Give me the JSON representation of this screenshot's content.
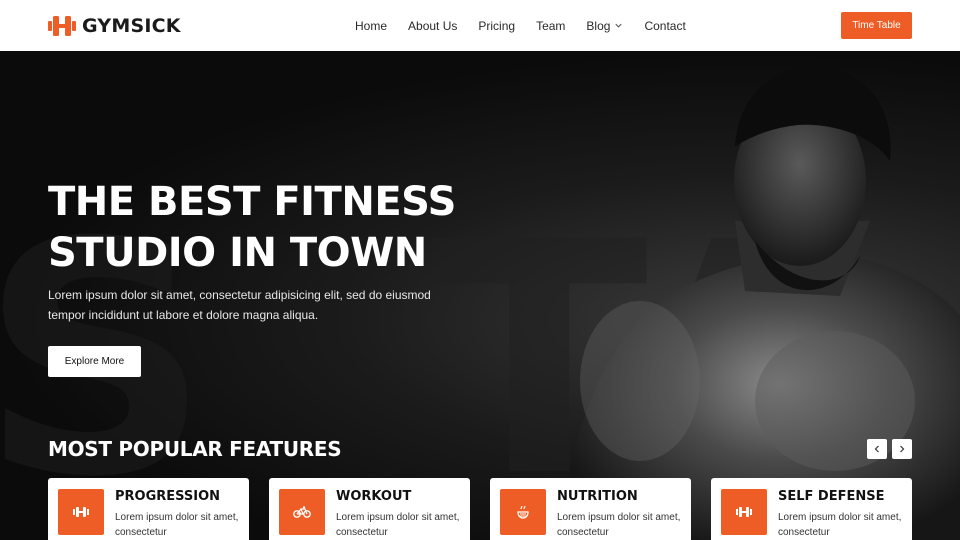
{
  "brand": {
    "name": "GYMSICK",
    "logo_icon": "dumbbell-icon",
    "accent": "#ee5d25"
  },
  "nav": {
    "items": [
      {
        "label": "Home"
      },
      {
        "label": "About Us"
      },
      {
        "label": "Pricing"
      },
      {
        "label": "Team"
      },
      {
        "label": "Blog"
      },
      {
        "label": "Contact"
      }
    ],
    "cta": "Time Table"
  },
  "hero": {
    "title_line1": "THE BEST FITNESS",
    "title_line2": "STUDIO IN TOWN",
    "desc_line1": "Lorem ipsum dolor sit amet, consectetur adipisicing elit, sed do eiusmod",
    "desc_line2": "tempor incididunt ut labore et dolore magna aliqua.",
    "button": "Explore More"
  },
  "features": {
    "heading": "MOST POPULAR FEATURES",
    "cards": [
      {
        "title": "PROGRESSION",
        "text1": "Lorem ipsum dolor sit amet,",
        "text2": "consectetur",
        "icon": "dumbbell-icon"
      },
      {
        "title": "WORKOUT",
        "text1": "Lorem ipsum dolor sit amet,",
        "text2": "consectetur",
        "icon": "bicycle-icon"
      },
      {
        "title": "NUTRITION",
        "text1": "Lorem ipsum dolor sit amet,",
        "text2": "consectetur",
        "icon": "nutrition-icon"
      },
      {
        "title": "SELF DEFENSE",
        "text1": "Lorem ipsum dolor sit amet,",
        "text2": "consectetur",
        "icon": "dumbbell-icon"
      }
    ]
  }
}
